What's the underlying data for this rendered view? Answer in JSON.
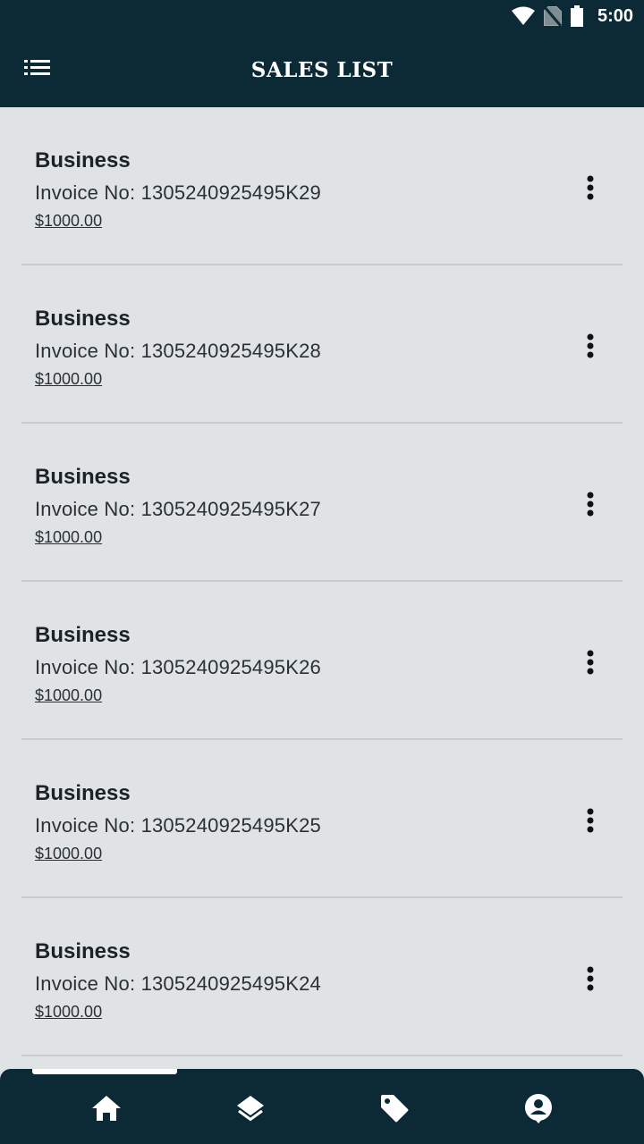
{
  "status_bar": {
    "time": "5:00",
    "icons": [
      "wifi-icon",
      "no-sim-icon",
      "battery-icon"
    ]
  },
  "app_bar": {
    "title": "SALES LIST",
    "menu_icon": "list-menu-icon"
  },
  "sales": [
    {
      "title": "Business",
      "invoice": "Invoice No: 1305240925495K29",
      "amount": "$1000.00"
    },
    {
      "title": "Business",
      "invoice": "Invoice No: 1305240925495K28",
      "amount": "$1000.00"
    },
    {
      "title": "Business",
      "invoice": "Invoice No: 1305240925495K27",
      "amount": "$1000.00"
    },
    {
      "title": "Business",
      "invoice": "Invoice No: 1305240925495K26",
      "amount": "$1000.00"
    },
    {
      "title": "Business",
      "invoice": "Invoice No: 1305240925495K25",
      "amount": "$1000.00"
    },
    {
      "title": "Business",
      "invoice": "Invoice No: 1305240925495K24",
      "amount": "$1000.00"
    }
  ],
  "bottom_nav": {
    "items": [
      "home-icon",
      "layers-icon",
      "tag-icon",
      "account-icon"
    ],
    "active_index": 0
  },
  "colors": {
    "bar_background": "#0b2a36",
    "page_background": "#dfe3e6",
    "divider": "#c7cbcf",
    "text_primary": "#1d2226"
  }
}
